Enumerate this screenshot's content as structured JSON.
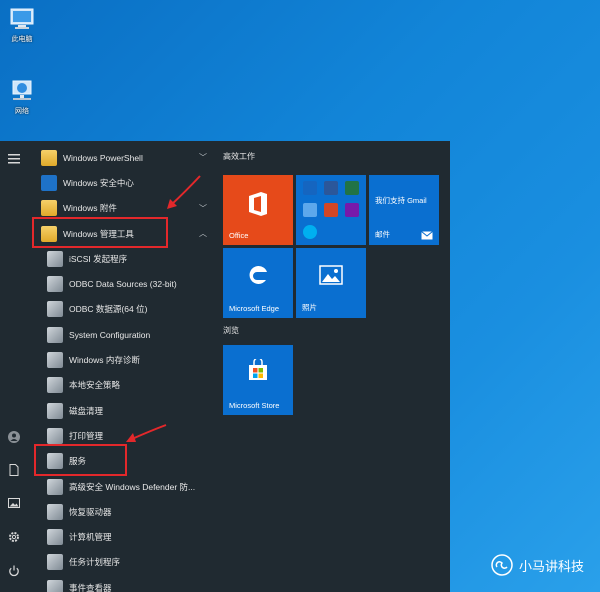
{
  "desktop": {
    "icons": [
      {
        "label": "此电脑",
        "icon": "computer-icon"
      },
      {
        "label": "网络",
        "icon": "network-icon"
      }
    ]
  },
  "start_menu": {
    "rail": [
      "hamburger-menu-icon",
      "user-avatar-icon",
      "documents-icon",
      "pictures-icon",
      "settings-icon",
      "power-icon"
    ],
    "app_list": [
      {
        "label": "Windows PowerShell",
        "icon": "folder-icon",
        "chevron": "﹀"
      },
      {
        "label": "Windows 安全中心",
        "icon": "shield-icon",
        "chevron": ""
      },
      {
        "label": "Windows 附件",
        "icon": "folder-icon",
        "chevron": "﹀"
      },
      {
        "label": "Windows 管理工具",
        "icon": "folder-icon",
        "chevron": "︿"
      },
      {
        "label": "iSCSI 发起程序",
        "icon": "iscsi-icon",
        "chevron": ""
      },
      {
        "label": "ODBC Data Sources (32-bit)",
        "icon": "odbc-icon",
        "chevron": ""
      },
      {
        "label": "ODBC 数据源(64 位)",
        "icon": "odbc-icon",
        "chevron": ""
      },
      {
        "label": "System Configuration",
        "icon": "system-config-icon",
        "chevron": ""
      },
      {
        "label": "Windows 内存诊断",
        "icon": "memory-diagnostic-icon",
        "chevron": ""
      },
      {
        "label": "本地安全策略",
        "icon": "security-policy-icon",
        "chevron": ""
      },
      {
        "label": "磁盘清理",
        "icon": "disk-cleanup-icon",
        "chevron": ""
      },
      {
        "label": "打印管理",
        "icon": "print-management-icon",
        "chevron": ""
      },
      {
        "label": "服务",
        "icon": "services-gear-icon",
        "chevron": ""
      },
      {
        "label": "高级安全 Windows Defender 防...",
        "icon": "firewall-icon",
        "chevron": ""
      },
      {
        "label": "恢复驱动器",
        "icon": "recovery-drive-icon",
        "chevron": ""
      },
      {
        "label": "计算机管理",
        "icon": "computer-management-icon",
        "chevron": ""
      },
      {
        "label": "任务计划程序",
        "icon": "task-scheduler-icon",
        "chevron": ""
      },
      {
        "label": "事件查看器",
        "icon": "event-viewer-icon",
        "chevron": ""
      }
    ],
    "tiles": {
      "group1_title": "高效工作",
      "group2_title": "浏览",
      "office": "Office",
      "gmail_text": "我们支持 Gmail",
      "mail": "邮件",
      "edge": "Microsoft Edge",
      "photos": "照片",
      "store": "Microsoft Store"
    }
  },
  "watermark": {
    "text": "小马讲科技"
  },
  "colors": {
    "start_bg": "#202a31",
    "tile_blue": "#0a6fd0",
    "office_red": "#e64a1a",
    "highlight_red": "#e3282b"
  }
}
